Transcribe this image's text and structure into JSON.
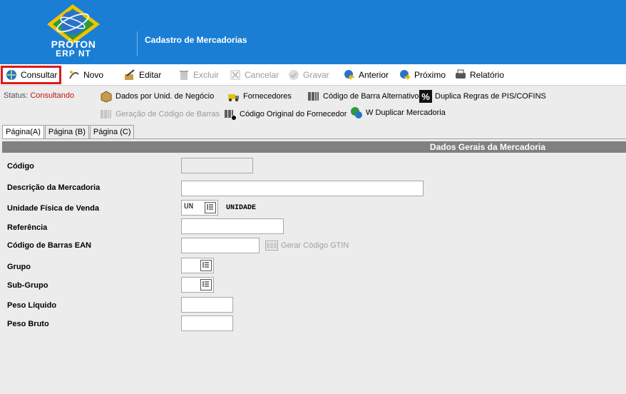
{
  "header": {
    "logo_line1": "PRÓTON",
    "logo_line2": "ERP NT",
    "title": "Cadastro de Mercadorias"
  },
  "toolbar": [
    {
      "label": "Consultar",
      "icon": "search-globe-icon",
      "enabled": true,
      "highlighted": true
    },
    {
      "label": "Novo",
      "icon": "new-document-icon",
      "enabled": true
    },
    {
      "label": "Editar",
      "icon": "edit-icon",
      "enabled": true
    },
    {
      "label": "Excluir",
      "icon": "delete-icon",
      "enabled": false
    },
    {
      "label": "Cancelar",
      "icon": "cancel-icon",
      "enabled": false
    },
    {
      "label": "Gravar",
      "icon": "save-icon",
      "enabled": false
    },
    {
      "label": "Anterior",
      "icon": "previous-icon",
      "enabled": true
    },
    {
      "label": "Próximo",
      "icon": "next-icon",
      "enabled": true
    },
    {
      "label": "Relatório",
      "icon": "report-icon",
      "enabled": true
    }
  ],
  "status": {
    "label": "Status:",
    "value": "Consultando"
  },
  "secondary_actions": [
    {
      "label": "Dados por Unid. de Negócio",
      "icon": "box-icon",
      "enabled": true
    },
    {
      "label": "Fornecedores",
      "icon": "truck-icon",
      "enabled": true
    },
    {
      "label": "Código de Barra Alternativo",
      "icon": "barcode-icon",
      "enabled": true
    },
    {
      "label": "Duplica Regras de PIS/COFINS",
      "icon": "percent-icon",
      "enabled": true
    },
    {
      "label": "Geração de Código de Barras",
      "icon": "barcode-icon",
      "enabled": false
    },
    {
      "label": "Código Original do Fornecedor",
      "icon": "barcode-add-icon",
      "enabled": true
    },
    {
      "label": "W Duplicar Mercadoria",
      "icon": "duplicate-icon",
      "enabled": true
    }
  ],
  "tabs": [
    {
      "label": "Página(A)",
      "active": true
    },
    {
      "label": "Página (B)",
      "active": false
    },
    {
      "label": "Página (C)",
      "active": false
    }
  ],
  "section_title": "Dados Gerais da Mercadoria",
  "form": {
    "codigo_label": "Código",
    "codigo_value": "",
    "descricao_label": "Descrição da Mercadoria",
    "descricao_value": "",
    "unidade_label": "Unidade Física de Venda",
    "unidade_value": "UN",
    "unidade_desc": "UNIDADE",
    "referencia_label": "Referência",
    "referencia_value": "",
    "ean_label": "Código de Barras EAN",
    "ean_value": "",
    "gtin_label": "Gerar Código GTIN",
    "grupo_label": "Grupo",
    "grupo_value": "",
    "subgrupo_label": "Sub-Grupo",
    "subgrupo_value": "",
    "peso_liquido_label": "Peso Líquido",
    "peso_liquido_value": "",
    "peso_bruto_label": "Peso Bruto",
    "peso_bruto_value": ""
  }
}
